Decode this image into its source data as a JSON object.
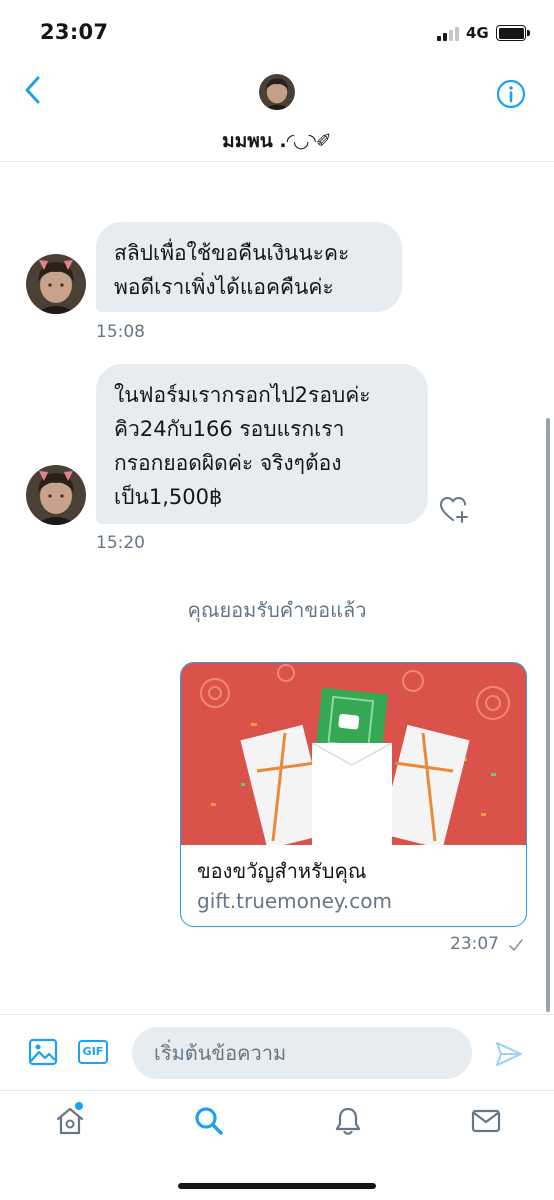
{
  "status_bar": {
    "time": "23:07",
    "network": "4G"
  },
  "header": {
    "contact_name": "มมพน .◜◡◝✐"
  },
  "messages": [
    {
      "direction": "incoming",
      "text_lines": [
        "สลิปเพื่อใช้ขอคืนเงินนะคะ",
        "พอดีเราเพิ่งได้แอคคืนค่ะ"
      ],
      "time": "15:08"
    },
    {
      "direction": "incoming",
      "text_lines": [
        "ในฟอร์มเรากรอกไป2รอบค่ะ",
        "คิว24กับ166 รอบแรกเรา",
        "กรอกยอดผิดค่ะ จริงๆต้อง",
        "เป็น1,500฿"
      ],
      "time": "15:20"
    }
  ],
  "system_message": "คุณยอมรับคำขอแล้ว",
  "link_card": {
    "title": "ของขวัญสำหรับคุณ",
    "domain": "gift.truemoney.com",
    "time": "23:07",
    "status_icon": "check-icon"
  },
  "composer": {
    "placeholder": "เริ่มต้นข้อความ",
    "gif_label": "GIF"
  },
  "tabs": [
    {
      "icon": "home-icon",
      "active": false,
      "notification_dot": true
    },
    {
      "icon": "search-icon",
      "active": true
    },
    {
      "icon": "bell-icon",
      "active": false
    },
    {
      "icon": "mail-icon",
      "active": false
    }
  ],
  "colors": {
    "accent": "#1da1f2",
    "bubble": "#e6ecf0",
    "muted_text": "#657786",
    "card_background": "#d9534a"
  }
}
